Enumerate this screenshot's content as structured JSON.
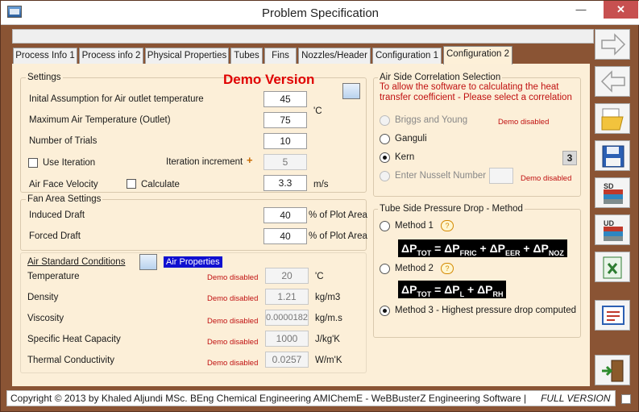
{
  "window": {
    "title": "Problem Specification"
  },
  "tabs": [
    "Process Info 1",
    "Process info 2",
    "Physical Properties",
    "Tubes",
    "Fins",
    "Nozzles/Header",
    "Configuration 1",
    "Configuration 2"
  ],
  "demo_version": "Demo Version",
  "settings": {
    "title": "Settings",
    "initial_label": "Inital Assumption for Air outlet temperature",
    "initial_value": "45",
    "max_temp_label": "Maximum Air Temperature (Outlet)",
    "max_temp_value": "75",
    "temp_unit": "'C",
    "trials_label": "Number of Trials",
    "trials_value": "10",
    "use_iteration_label": "Use Iteration",
    "iteration_increment_label": "Iteration increment",
    "iteration_increment_value": "5",
    "plus": "+",
    "face_velocity_label": "Air Face Velocity",
    "calculate_label": "Calculate",
    "face_velocity_value": "3.3",
    "face_velocity_unit": "m/s"
  },
  "fan_area": {
    "title": "Fan Area Settings",
    "induced_label": "Induced Draft",
    "induced_value": "40",
    "forced_label": "Forced Draft",
    "forced_value": "40",
    "unit": "% of Plot Area"
  },
  "air_standard": {
    "title": "Air Standard Conditions",
    "air_properties": "Air Properties",
    "demo_disabled": "Demo disabled",
    "rows": [
      {
        "label": "Temperature",
        "value": "20",
        "unit": "'C"
      },
      {
        "label": "Density",
        "value": "1.21",
        "unit": "kg/m3"
      },
      {
        "label": "Viscosity",
        "value": "0.0000182",
        "unit": "kg/m.s"
      },
      {
        "label": "Specific Heat Capacity",
        "value": "1000",
        "unit": "J/kg'K"
      },
      {
        "label": "Thermal Conductivity",
        "value": "0.0257",
        "unit": "W/m'K"
      }
    ]
  },
  "air_correlation": {
    "title": "Air Side Correlation Selection",
    "note": "To allow the software to calculating the heat transfer coefficient - Please select a correlation",
    "options": [
      "Briggs and Young",
      "Ganguli",
      "Kern",
      "Enter Nusselt Number"
    ],
    "demo_disabled": "Demo disabled",
    "badge": "3"
  },
  "tube_side": {
    "title": "Tube Side Pressure Drop - Method",
    "method1": "Method 1",
    "method2": "Method 2",
    "method3": "Method 3 - Highest pressure drop computed",
    "tooltip": "?"
  },
  "status": {
    "copyright": "Copyright © 2013 by Khaled Aljundi MSc. BEng Chemical Engineering AMIChemE - WeBBusterZ Engineering Software  |",
    "edition": "FULL VERSION"
  },
  "colors": {
    "frame": "#8a5434",
    "panel": "#fcefd8",
    "demo_red": "#c01010",
    "highlight": "#1010d0"
  }
}
